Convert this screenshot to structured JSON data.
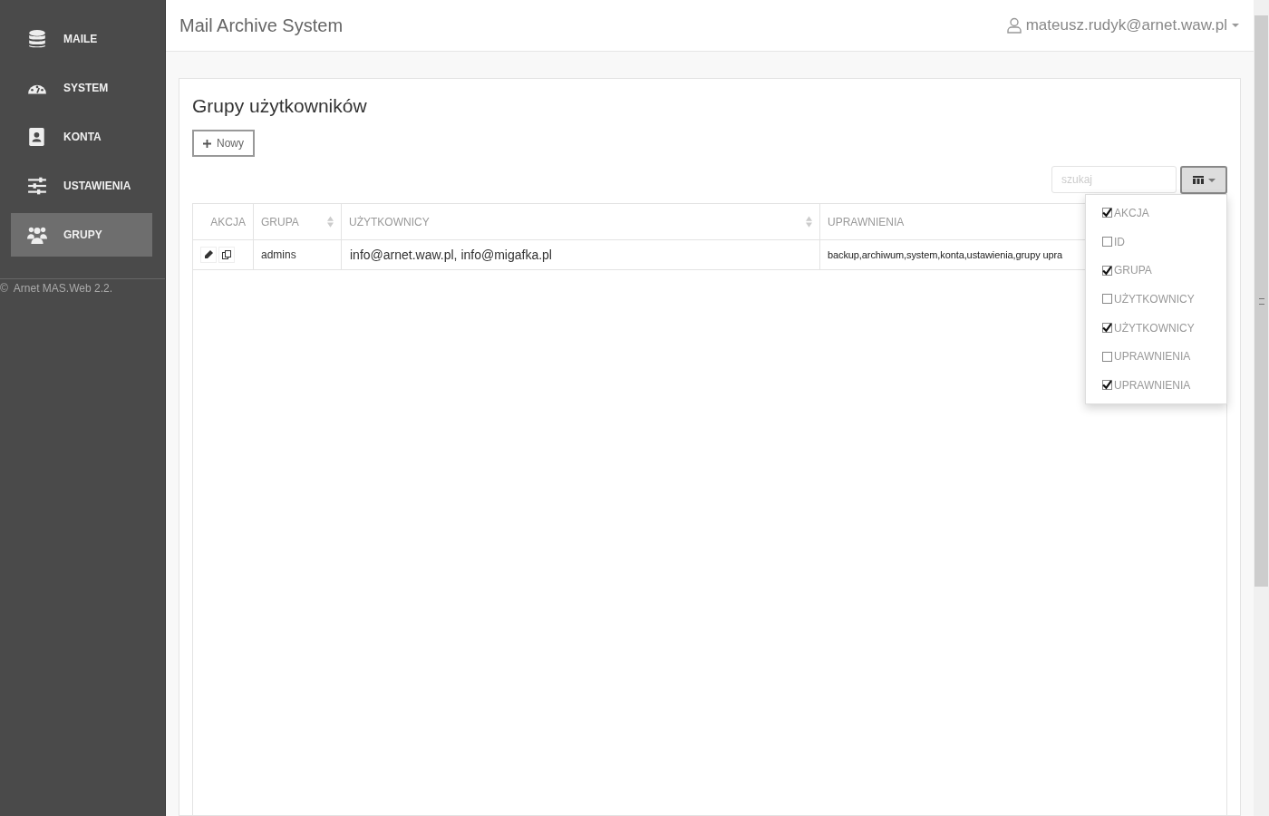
{
  "sidebar": {
    "items": [
      {
        "label": "MAILE",
        "kind": "database",
        "selected": false
      },
      {
        "label": "SYSTEM",
        "kind": "gauge",
        "selected": false
      },
      {
        "label": "KONTA",
        "kind": "contact",
        "selected": false
      },
      {
        "label": "USTAWIENIA",
        "kind": "sliders",
        "selected": false
      },
      {
        "label": "GRUPY",
        "kind": "users",
        "selected": true
      }
    ],
    "footer_symbol": "©",
    "footer": "Arnet MAS.Web 2.2."
  },
  "header": {
    "title": "Mail Archive System",
    "user": "mateusz.rudyk@arnet.waw.pl"
  },
  "page": {
    "title": "Grupy użytkowników",
    "new_button": "Nowy"
  },
  "search": {
    "placeholder": "szukaj"
  },
  "table": {
    "columns": [
      {
        "label": "AKCJA",
        "sortable": false
      },
      {
        "label": "GRUPA",
        "sortable": true
      },
      {
        "label": "UŻYTKOWNICY",
        "sortable": true
      },
      {
        "label": "UPRAWNIENIA"
      }
    ],
    "rows": [
      {
        "group": "admins",
        "users": "info@arnet.waw.pl, info@migafka.pl",
        "permissions": "backup,archiwum,system,konta,ustawienia,grupy upra"
      }
    ]
  },
  "column_menu": {
    "items": [
      {
        "label": "AKCJA",
        "checked": true
      },
      {
        "label": "ID",
        "checked": false
      },
      {
        "label": "GRUPA",
        "checked": true
      },
      {
        "label": "UŻYTKOWNICY",
        "checked": false
      },
      {
        "label": "UŻYTKOWNICY",
        "checked": true
      },
      {
        "label": "UPRAWNIENIA",
        "checked": false
      },
      {
        "label": "UPRAWNIENIA",
        "checked": true
      }
    ]
  }
}
